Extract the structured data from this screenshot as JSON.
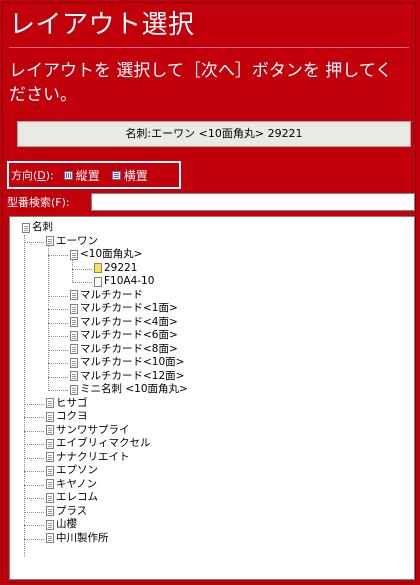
{
  "title": "レイアウト選択",
  "instruction": "レイアウトを 選択して［次へ］ボタンを 押してください。",
  "selection": "名刺:エーワン <10面角丸> 29221",
  "orientation": {
    "label_prefix": "方向(",
    "label_key": "D",
    "label_suffix": "):",
    "portrait": "縦置",
    "landscape": "横置"
  },
  "search": {
    "label": "型番検索(F):",
    "value": ""
  },
  "tree": {
    "root": "名刺",
    "awan": "エーワン",
    "awan_10": "<10面角丸>",
    "awan_10_a": "29221",
    "awan_10_b": "F10A4-10",
    "awan_items": [
      "マルチカード",
      "マルチカード<1面>",
      "マルチカード<4面>",
      "マルチカード<6面>",
      "マルチカード<8面>",
      "マルチカード<10面>",
      "マルチカード<12面>",
      "ミニ名刺 <10面角丸>"
    ],
    "makers": [
      "ヒサゴ",
      "コクヨ",
      "サンワサプライ",
      "エイブリィマクセル",
      "ナナクリエイト",
      "エプソン",
      "キヤノン",
      "エレコム",
      "プラス",
      "山櫻",
      "中川製作所"
    ]
  }
}
